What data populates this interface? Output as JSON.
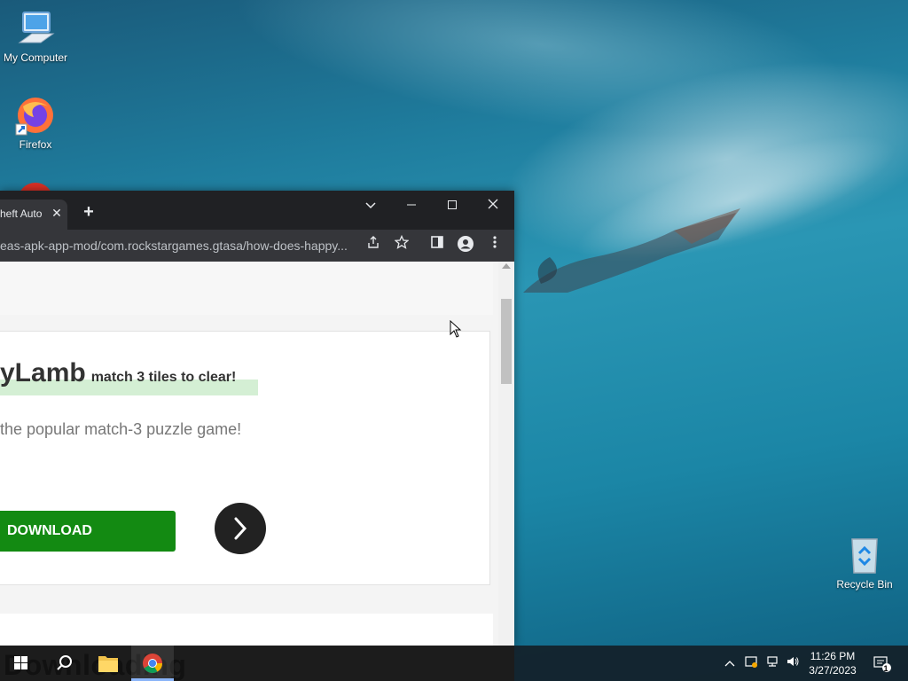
{
  "desktop": {
    "icons": [
      {
        "label": "My Computer"
      },
      {
        "label": "Firefox"
      },
      {
        "label": "Recycle Bin"
      }
    ]
  },
  "browser": {
    "tab_title": "heft Auto",
    "url": "eas-apk-app-mod/com.rockstargames.gtasa/how-does-happy...",
    "ad": {
      "title_big": "yLamb",
      "title_small": "match 3 tiles to clear!",
      "description": "the popular match-3 puzzle game!",
      "download_label": "DOWNLOAD"
    }
  },
  "taskbar": {
    "overlay_text": "Downloading",
    "time": "11:26 PM",
    "date": "3/27/2023",
    "notification_count": "1"
  },
  "colors": {
    "download_button": "#138a12",
    "chrome_dark": "#202124",
    "accent": "#8ab4f8"
  }
}
